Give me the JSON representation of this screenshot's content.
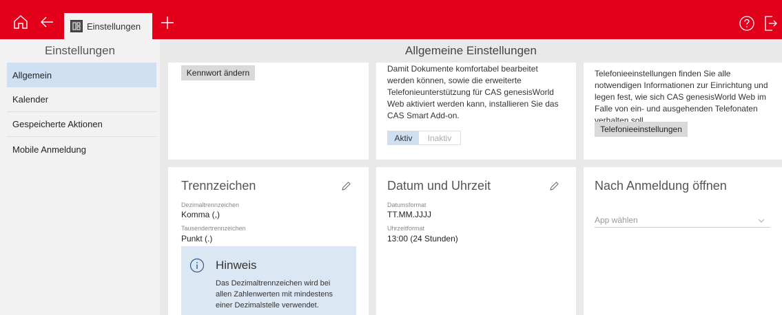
{
  "topbar": {
    "home_icon": "home-icon",
    "back_icon": "arrow-left-icon",
    "tab_label": "Einstellungen",
    "add_icon": "plus-icon",
    "help_icon": "help-icon",
    "logout_icon": "logout-icon",
    "accent": "#e3001b"
  },
  "sidebar": {
    "title": "Einstellungen",
    "items": [
      {
        "label": "Allgemein"
      },
      {
        "label": "Kalender"
      },
      {
        "label": "Gespeicherte Aktionen"
      },
      {
        "label": "Mobile Anmeldung"
      }
    ]
  },
  "main": {
    "title": "Allgemeine Einstellungen",
    "password_card": {
      "button": "Kennwort ändern"
    },
    "addon_card": {
      "text": "Damit Dokumente komfortabel bearbeitet werden können, sowie die erweiterte Telefonieunterstützung für CAS genesisWorld Web aktiviert werden kann, installieren Sie das CAS Smart Add-on.",
      "toggle_active": "Aktiv",
      "toggle_inactive": "Inaktiv"
    },
    "telephony_card": {
      "text": "Telefonieeinstellungen finden Sie alle notwendigen Informationen zur Einrichtung und legen fest, wie sich CAS genesisWorld Web im Falle von ein- und ausgehenden Telefonaten verhalten soll.",
      "button": "Telefonieeinstellungen"
    },
    "separator_card": {
      "title": "Trennzeichen",
      "decimal_label": "Dezimaltrennzeichen",
      "decimal_value": "Komma (,)",
      "thousands_label": "Tausendertrennzeichen",
      "thousands_value": "Punkt (.)",
      "hint_title": "Hinweis",
      "hint_text": "Das Dezimaltrennzeichen wird bei allen Zahlenwerten mit mindestens einer Dezimalstelle verwendet."
    },
    "datetime_card": {
      "title": "Datum und Uhrzeit",
      "date_label": "Datumsformat",
      "date_value": "TT.MM.JJJJ",
      "time_label": "Uhrzeitformat",
      "time_value": "13:00 (24 Stunden)"
    },
    "login_card": {
      "title": "Nach Anmeldung öffnen",
      "select_placeholder": "App wählen"
    }
  }
}
